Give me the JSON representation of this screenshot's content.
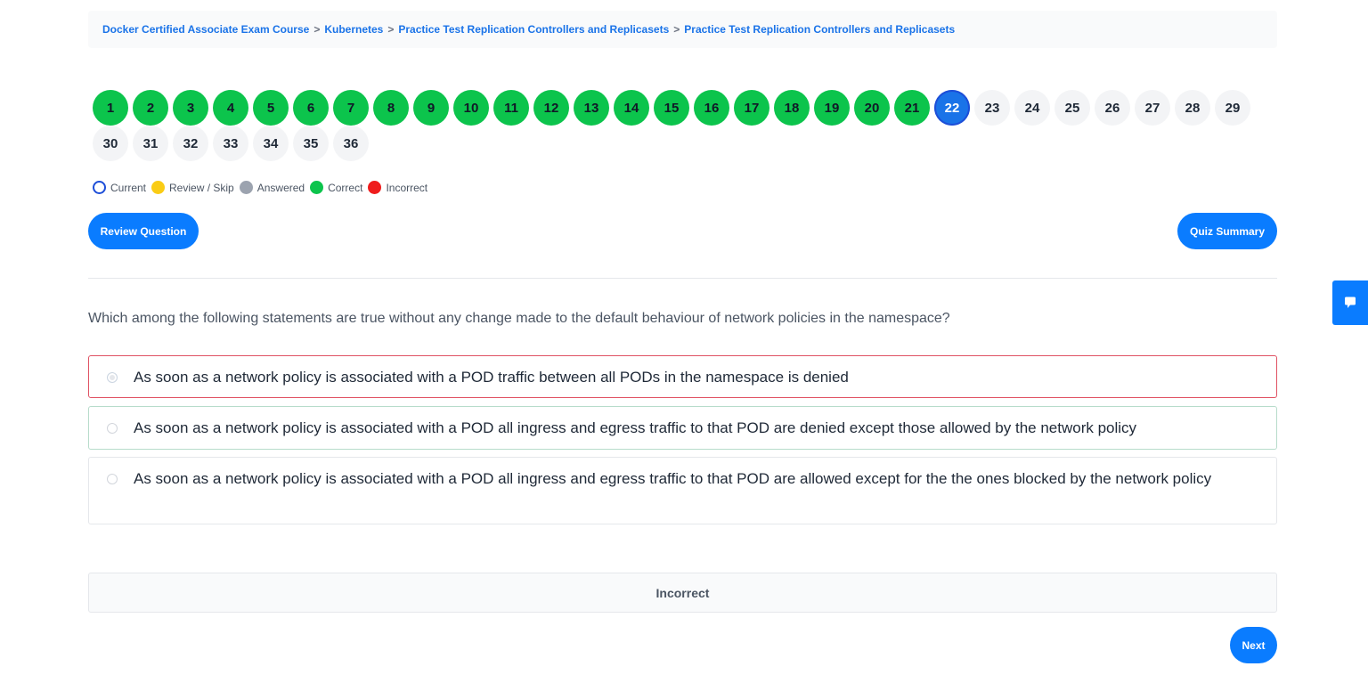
{
  "breadcrumb": {
    "items": [
      "Docker Certified Associate Exam Course",
      "Kubernetes",
      "Practice Test Replication Controllers and Replicasets",
      "Practice Test Replication Controllers and Replicasets"
    ],
    "separator": ">"
  },
  "question_nav": {
    "current": 22,
    "questions": [
      {
        "n": "1",
        "state": "correct"
      },
      {
        "n": "2",
        "state": "correct"
      },
      {
        "n": "3",
        "state": "correct"
      },
      {
        "n": "4",
        "state": "correct"
      },
      {
        "n": "5",
        "state": "correct"
      },
      {
        "n": "6",
        "state": "correct"
      },
      {
        "n": "7",
        "state": "correct"
      },
      {
        "n": "8",
        "state": "correct"
      },
      {
        "n": "9",
        "state": "correct"
      },
      {
        "n": "10",
        "state": "correct"
      },
      {
        "n": "11",
        "state": "correct"
      },
      {
        "n": "12",
        "state": "correct"
      },
      {
        "n": "13",
        "state": "correct"
      },
      {
        "n": "14",
        "state": "correct"
      },
      {
        "n": "15",
        "state": "correct"
      },
      {
        "n": "16",
        "state": "correct"
      },
      {
        "n": "17",
        "state": "correct"
      },
      {
        "n": "18",
        "state": "correct"
      },
      {
        "n": "19",
        "state": "correct"
      },
      {
        "n": "20",
        "state": "correct"
      },
      {
        "n": "21",
        "state": "correct"
      },
      {
        "n": "22",
        "state": "current"
      },
      {
        "n": "23",
        "state": "unanswered"
      },
      {
        "n": "24",
        "state": "unanswered"
      },
      {
        "n": "25",
        "state": "unanswered"
      },
      {
        "n": "26",
        "state": "unanswered"
      },
      {
        "n": "27",
        "state": "unanswered"
      },
      {
        "n": "28",
        "state": "unanswered"
      },
      {
        "n": "29",
        "state": "unanswered"
      },
      {
        "n": "30",
        "state": "unanswered"
      },
      {
        "n": "31",
        "state": "unanswered"
      },
      {
        "n": "32",
        "state": "unanswered"
      },
      {
        "n": "33",
        "state": "unanswered"
      },
      {
        "n": "34",
        "state": "unanswered"
      },
      {
        "n": "35",
        "state": "unanswered"
      },
      {
        "n": "36",
        "state": "unanswered"
      }
    ]
  },
  "legend": {
    "current": "Current",
    "review": "Review / Skip",
    "answered": "Answered",
    "correct": "Correct",
    "incorrect": "Incorrect"
  },
  "buttons": {
    "review": "Review Question",
    "summary": "Quiz Summary",
    "next": "Next"
  },
  "question": {
    "text": "Which among the following statements are true without any change made to the default behaviour of network policies in the namespace?",
    "answers": [
      "As soon as a network policy is associated with a POD traffic between all PODs in the namespace is denied",
      "As soon as a network policy is associated with a POD all ingress and egress traffic to that POD are denied except those allowed by the network policy",
      "As soon as a network policy is associated with a POD all ingress and egress traffic to that POD are allowed except for the the ones blocked by the network policy"
    ],
    "selected_index": 0
  },
  "result": {
    "text": "Incorrect"
  },
  "colors": {
    "accent": "#0a7cff",
    "correct": "#0cc44c",
    "incorrect": "#ef1c1c",
    "review": "#facc15",
    "answered": "#9ca3af"
  },
  "icons": {
    "feedback": "chat-bubble-icon"
  }
}
